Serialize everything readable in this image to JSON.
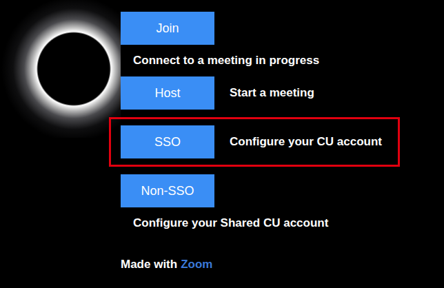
{
  "options": [
    {
      "button": "Join",
      "description": "Connect to a meeting in progress",
      "kind": "below",
      "highlighted": false
    },
    {
      "button": "Host",
      "description": "Start a meeting",
      "kind": "beside",
      "highlighted": false
    },
    {
      "button": "SSO",
      "description": "Configure your CU account",
      "kind": "beside",
      "highlighted": true
    },
    {
      "button": "Non-SSO",
      "description": "Configure your Shared CU account",
      "kind": "below",
      "highlighted": false
    }
  ],
  "footer": {
    "text": "Made with",
    "link": "Zoom"
  }
}
